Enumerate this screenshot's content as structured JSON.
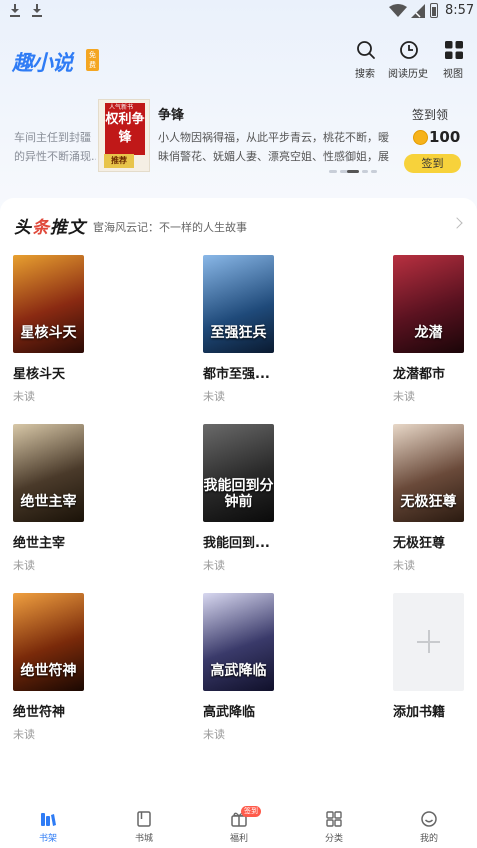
{
  "status_bar": {
    "time": "8:57"
  },
  "header": {
    "logo": "趣小说",
    "logo_tag": "免费",
    "buttons": [
      {
        "label": "搜索",
        "icon": "search-icon"
      },
      {
        "label": "阅读历史",
        "icon": "clock-icon"
      },
      {
        "label": "视图",
        "icon": "grid-view-icon"
      }
    ]
  },
  "recommend": {
    "left_text": [
      "车间主任到封疆",
      "的异性不断涌现..."
    ],
    "cover_title": "权利争锋",
    "cover_top": "人气新书",
    "cover_tag": "推荐",
    "title": "争锋",
    "desc": "小人物因祸得福，从此平步青云，桃花不断，暧昧俏警花、妩媚人妻、漂亮空姐、性感御姐，展现最"
  },
  "signin": {
    "title": "签到领",
    "coins": "100",
    "button": "签到"
  },
  "headline": {
    "title_a": "头",
    "title_b": "条",
    "title_c": "推文",
    "subtitle": "宦海风云记：不一样的人生故事"
  },
  "books": [
    {
      "name": "星核斗天",
      "status": "未读",
      "cover_text": "星核斗天",
      "cover_color": "#8a2a12"
    },
    {
      "name": "都市至强...",
      "status": "未读",
      "cover_text": "至强狂兵",
      "cover_color": "#1f4a7a"
    },
    {
      "name": "龙潜都市",
      "status": "未读",
      "cover_text": "龙潜",
      "cover_color": "#5a1220"
    },
    {
      "name": "绝世主宰",
      "status": "未读",
      "cover_text": "绝世主宰",
      "cover_color": "#4a3a2a"
    },
    {
      "name": "我能回到...",
      "status": "未读",
      "cover_text": "我能回到分钟前",
      "cover_color": "#2a2a2a"
    },
    {
      "name": "无极狂尊",
      "status": "未读",
      "cover_text": "无极狂尊",
      "cover_color": "#6a4a3a"
    },
    {
      "name": "绝世符神",
      "status": "未读",
      "cover_text": "绝世符神",
      "cover_color": "#7a2a0a"
    },
    {
      "name": "高武降临",
      "status": "未读",
      "cover_text": "高武降临",
      "cover_color": "#3a3a6a"
    },
    {
      "name": "添加书籍",
      "status": "",
      "cover_text": "",
      "cover_color": "#f1f2f4"
    }
  ],
  "bottom_nav": [
    {
      "label": "书架",
      "icon": "bookshelf-icon",
      "active": true
    },
    {
      "label": "书城",
      "icon": "book-icon",
      "active": false
    },
    {
      "label": "福利",
      "icon": "gift-icon",
      "active": false,
      "badge": "签到"
    },
    {
      "label": "分类",
      "icon": "category-icon",
      "active": false
    },
    {
      "label": "我的",
      "icon": "profile-icon",
      "active": false
    }
  ]
}
